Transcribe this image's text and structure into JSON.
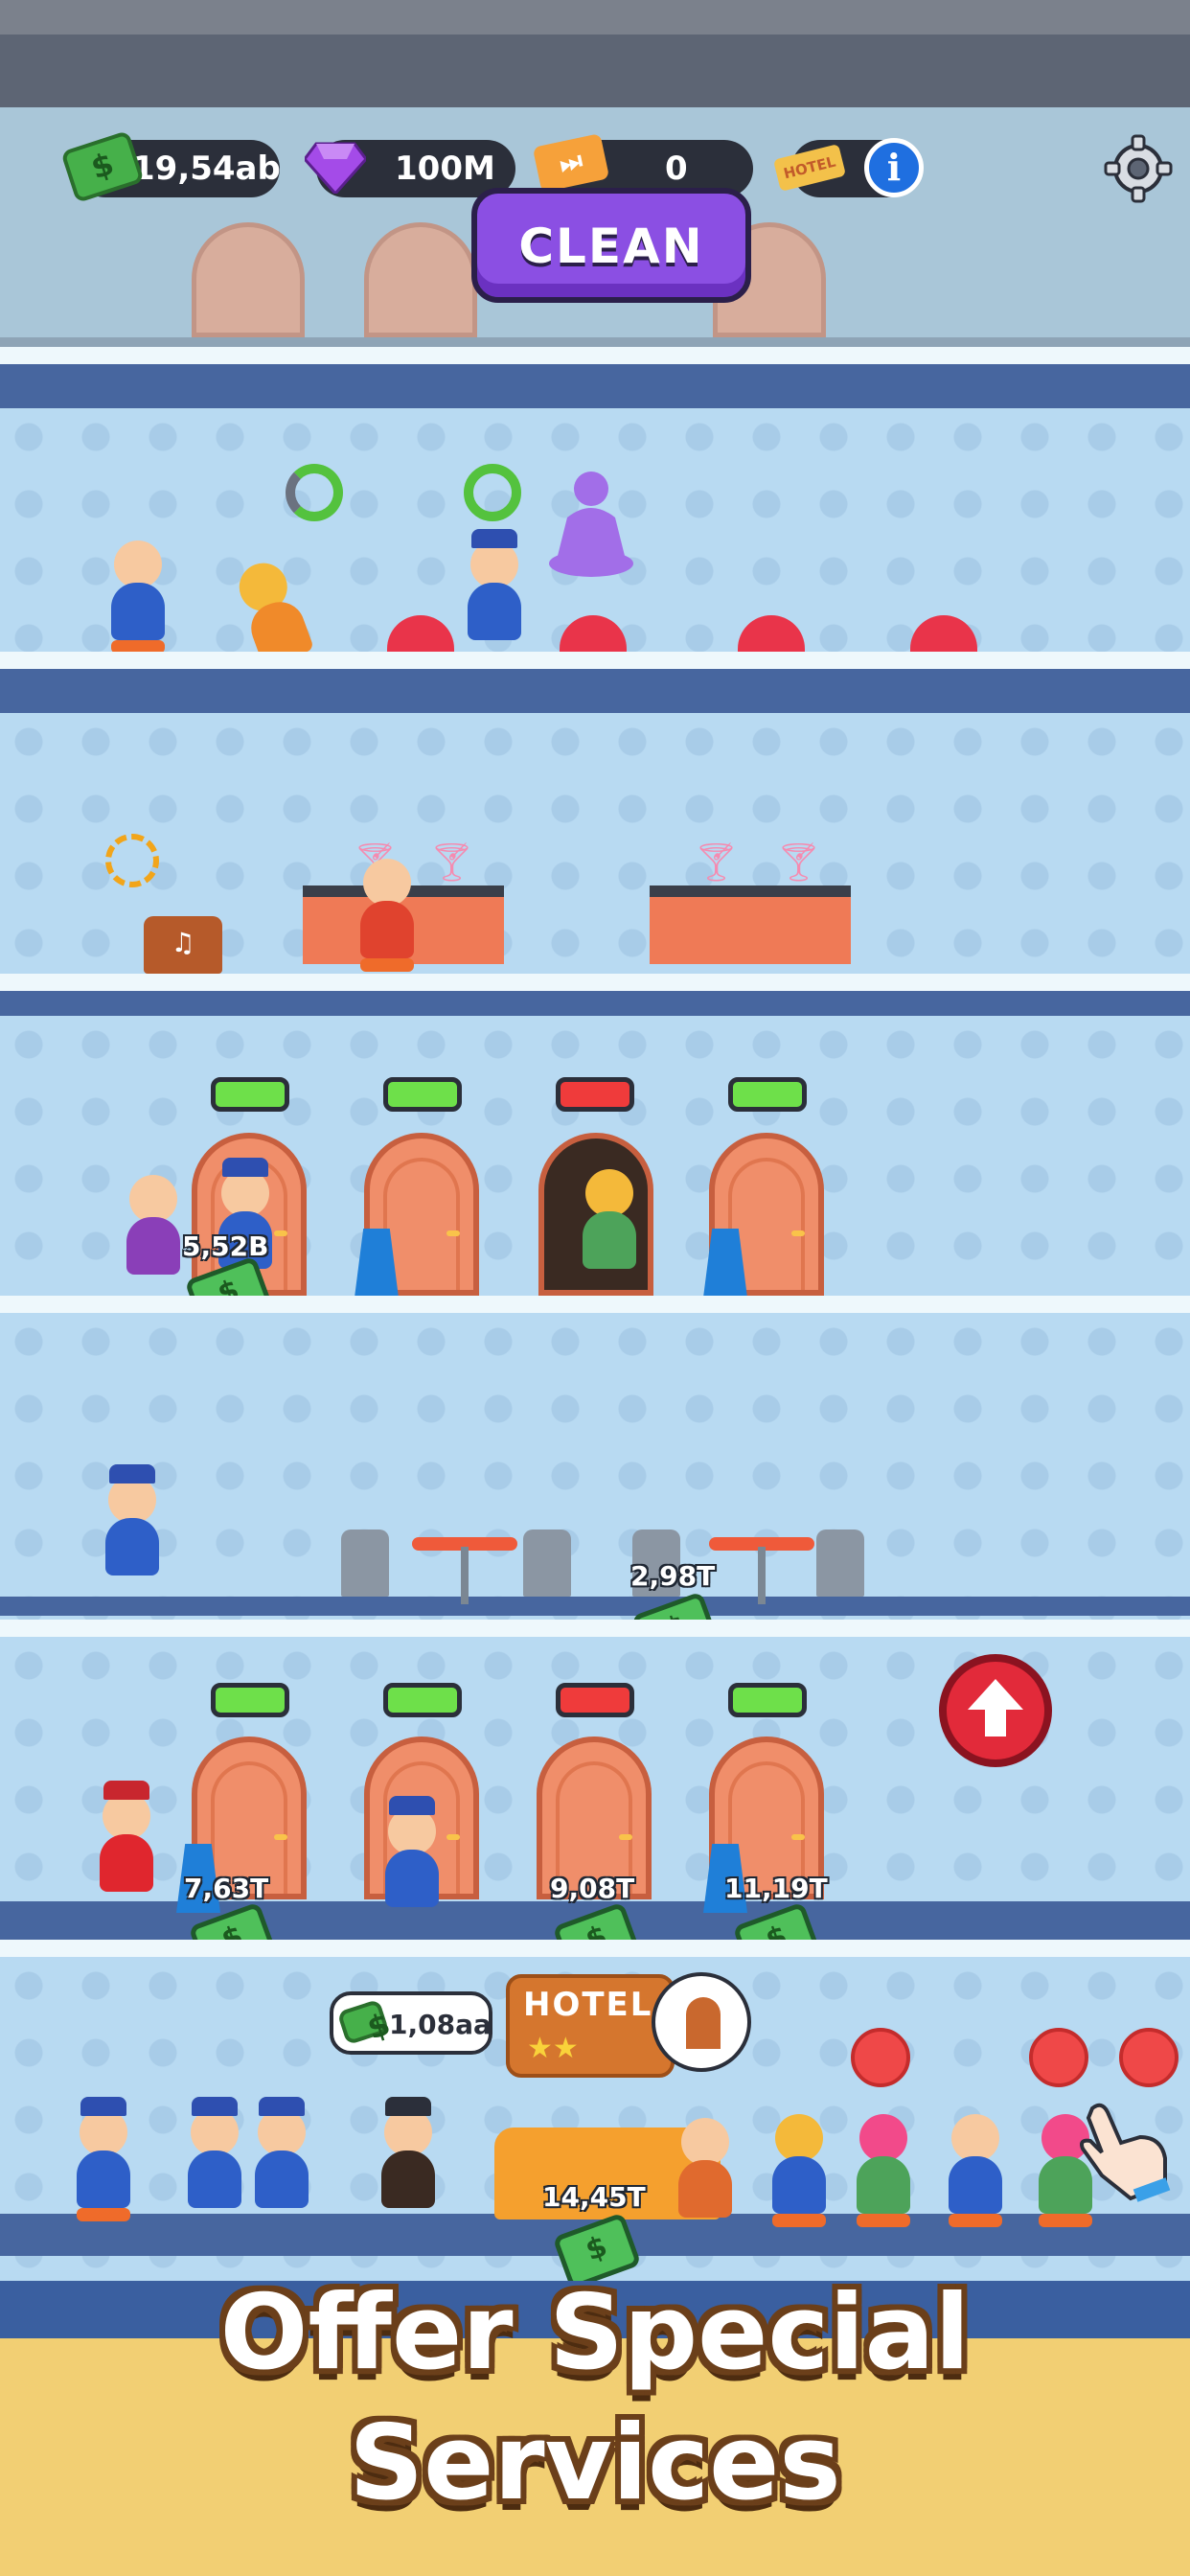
{
  "hud": {
    "cash": "19,54ab",
    "gems": "100M",
    "tickets": "0",
    "hotel_tag": "HOTEL",
    "info_label": "i",
    "clean_button": "CLEAN"
  },
  "floors": {
    "rooms_upper": {
      "indicators": [
        "green",
        "green",
        "red",
        "green"
      ],
      "money_label": "5,52B"
    },
    "restaurant": {
      "money_label": "2,98T"
    },
    "rooms_lower": {
      "indicators": [
        "green",
        "green",
        "red",
        "green"
      ],
      "money_labels": [
        "7,63T",
        "9,08T",
        "11,19T"
      ]
    },
    "lobby": {
      "bubble_value": "1,08aa",
      "hotel_sign_name": "HOTEL",
      "hotel_sign_stars": "★★",
      "money_label": "14,45T"
    }
  },
  "banner": {
    "line1": "Offer Special",
    "line2": "Services"
  },
  "colors": {
    "accent_purple": "#8b4fe3",
    "cash_green": "#4fc05a",
    "status_red": "#ef3b3b",
    "status_green": "#6ee04a"
  }
}
